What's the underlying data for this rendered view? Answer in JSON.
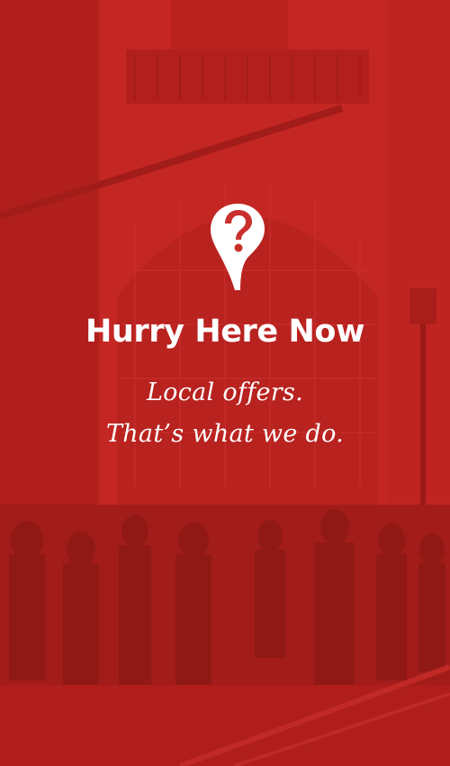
{
  "app": {
    "name": "Hurry Here Now",
    "tagline_line1": "Local offers.",
    "tagline_line2": "That’s what we do."
  },
  "logo": {
    "icon": "map-pin-question-icon"
  },
  "colors": {
    "overlay_red": "#d8322c",
    "text": "#ffffff"
  }
}
